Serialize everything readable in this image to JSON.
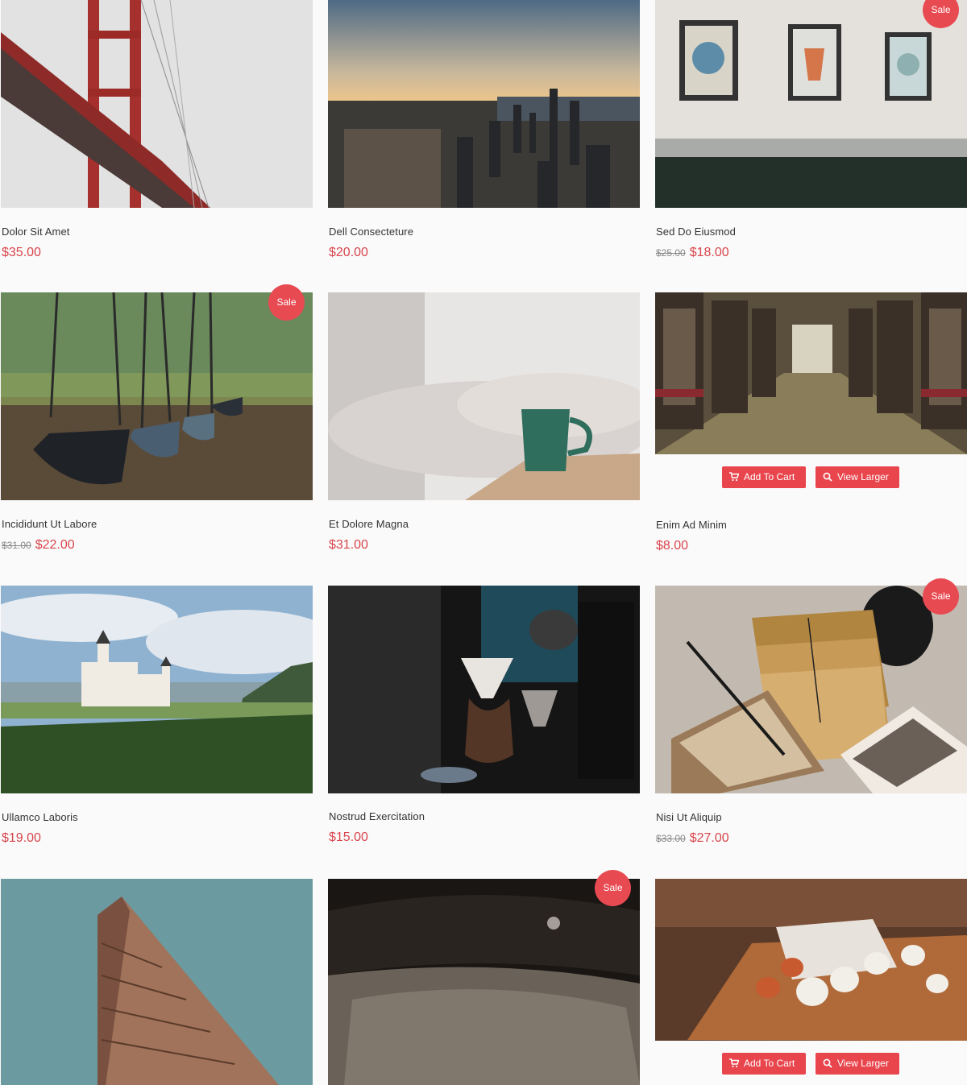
{
  "products": [
    {
      "title": "Dolor Sit Amet",
      "price": "$35.00",
      "old_price": "",
      "sale": "",
      "image": "bridge",
      "buttons": false
    },
    {
      "title": "Dell Consecteture",
      "price": "$20.00",
      "old_price": "",
      "sale": "",
      "image": "city-skyline",
      "buttons": false
    },
    {
      "title": "Sed Do Eiusmod",
      "price": "$18.00",
      "old_price": "$25.00",
      "sale": "Sale",
      "image": "framed-pictures",
      "buttons": false
    },
    {
      "title": "Incididunt Ut Labore",
      "price": "$22.00",
      "old_price": "$31.00",
      "sale": "Sale",
      "image": "swings",
      "buttons": false
    },
    {
      "title": "Et Dolore Magna",
      "price": "$31.00",
      "old_price": "",
      "sale": "",
      "image": "coffee-cup",
      "buttons": false
    },
    {
      "title": "Enim Ad Minim",
      "price": "$8.00",
      "old_price": "",
      "sale": "",
      "image": "train-interior",
      "buttons": true
    },
    {
      "title": "Ullamco Laboris",
      "price": "$19.00",
      "old_price": "",
      "sale": "",
      "image": "castle",
      "buttons": false
    },
    {
      "title": "Nostrud Exercitation",
      "price": "$15.00",
      "old_price": "",
      "sale": "",
      "image": "coffee-brewing",
      "buttons": false
    },
    {
      "title": "Nisi Ut Aliquip",
      "price": "$27.00",
      "old_price": "$33.00",
      "sale": "Sale",
      "image": "letters-and-photos",
      "buttons": false
    },
    {
      "title": "",
      "price": "",
      "old_price": "",
      "sale": "",
      "image": "flatiron-building",
      "buttons": false
    },
    {
      "title": "",
      "price": "",
      "old_price": "",
      "sale": "Sale",
      "image": "vintage-car",
      "buttons": false
    },
    {
      "title": "",
      "price": "",
      "old_price": "",
      "sale": "",
      "image": "mugs-on-table",
      "buttons": true
    }
  ],
  "buttons": {
    "add_to_cart": "Add To Cart",
    "view_larger": "View Larger"
  },
  "colors": {
    "accent": "#e8454d",
    "price": "#d9454c",
    "background": "#fafafa"
  },
  "icons": {
    "cart": "cart-icon",
    "zoom": "search-icon"
  }
}
